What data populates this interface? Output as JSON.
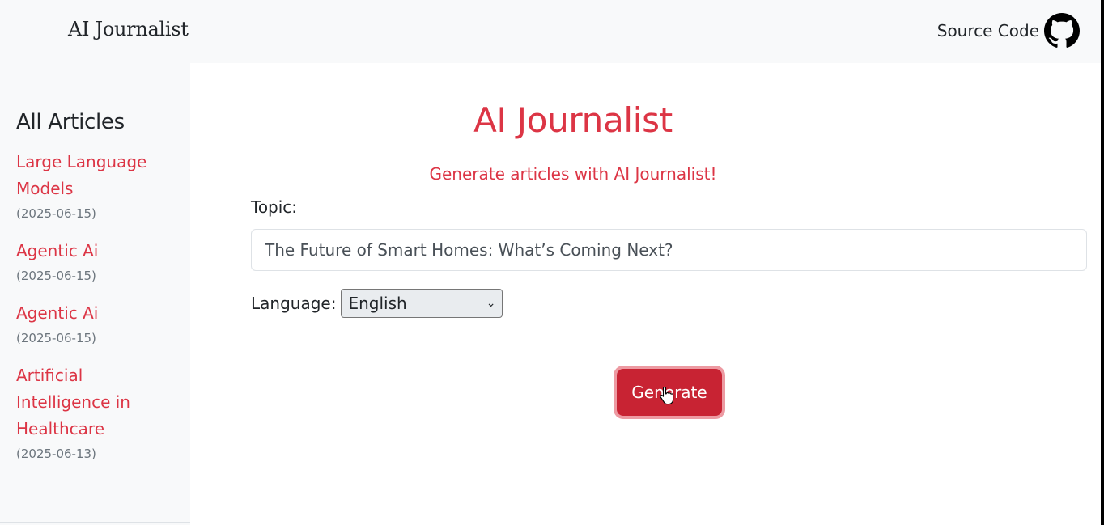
{
  "navbar": {
    "brand": "AI Journalist",
    "source_label": "Source Code",
    "source_icon": "github-icon"
  },
  "sidebar": {
    "title": "All Articles",
    "articles": [
      {
        "title_lines": [
          "Large Language",
          "Models"
        ],
        "date": "(2025-06-15)"
      },
      {
        "title_lines": [
          "Agentic Ai"
        ],
        "date": "(2025-06-15)"
      },
      {
        "title_lines": [
          "Agentic Ai"
        ],
        "date": "(2025-06-15)"
      },
      {
        "title_lines": [
          "Artificial",
          "Intelligence in",
          "Healthcare"
        ],
        "date": "(2025-06-13)"
      }
    ]
  },
  "main": {
    "title": "AI Journalist",
    "subtitle": "Generate articles with AI Journalist!",
    "topic_label": "Topic:",
    "topic_value": "The Future of Smart Homes: What’s Coming Next?",
    "language_label": "Language:",
    "language_selected": "English",
    "generate_label": "Generate"
  },
  "colors": {
    "accent": "#dc3545",
    "button": "#c82333",
    "muted": "#6c757d",
    "sidebar_bg": "#f8f9fa"
  }
}
